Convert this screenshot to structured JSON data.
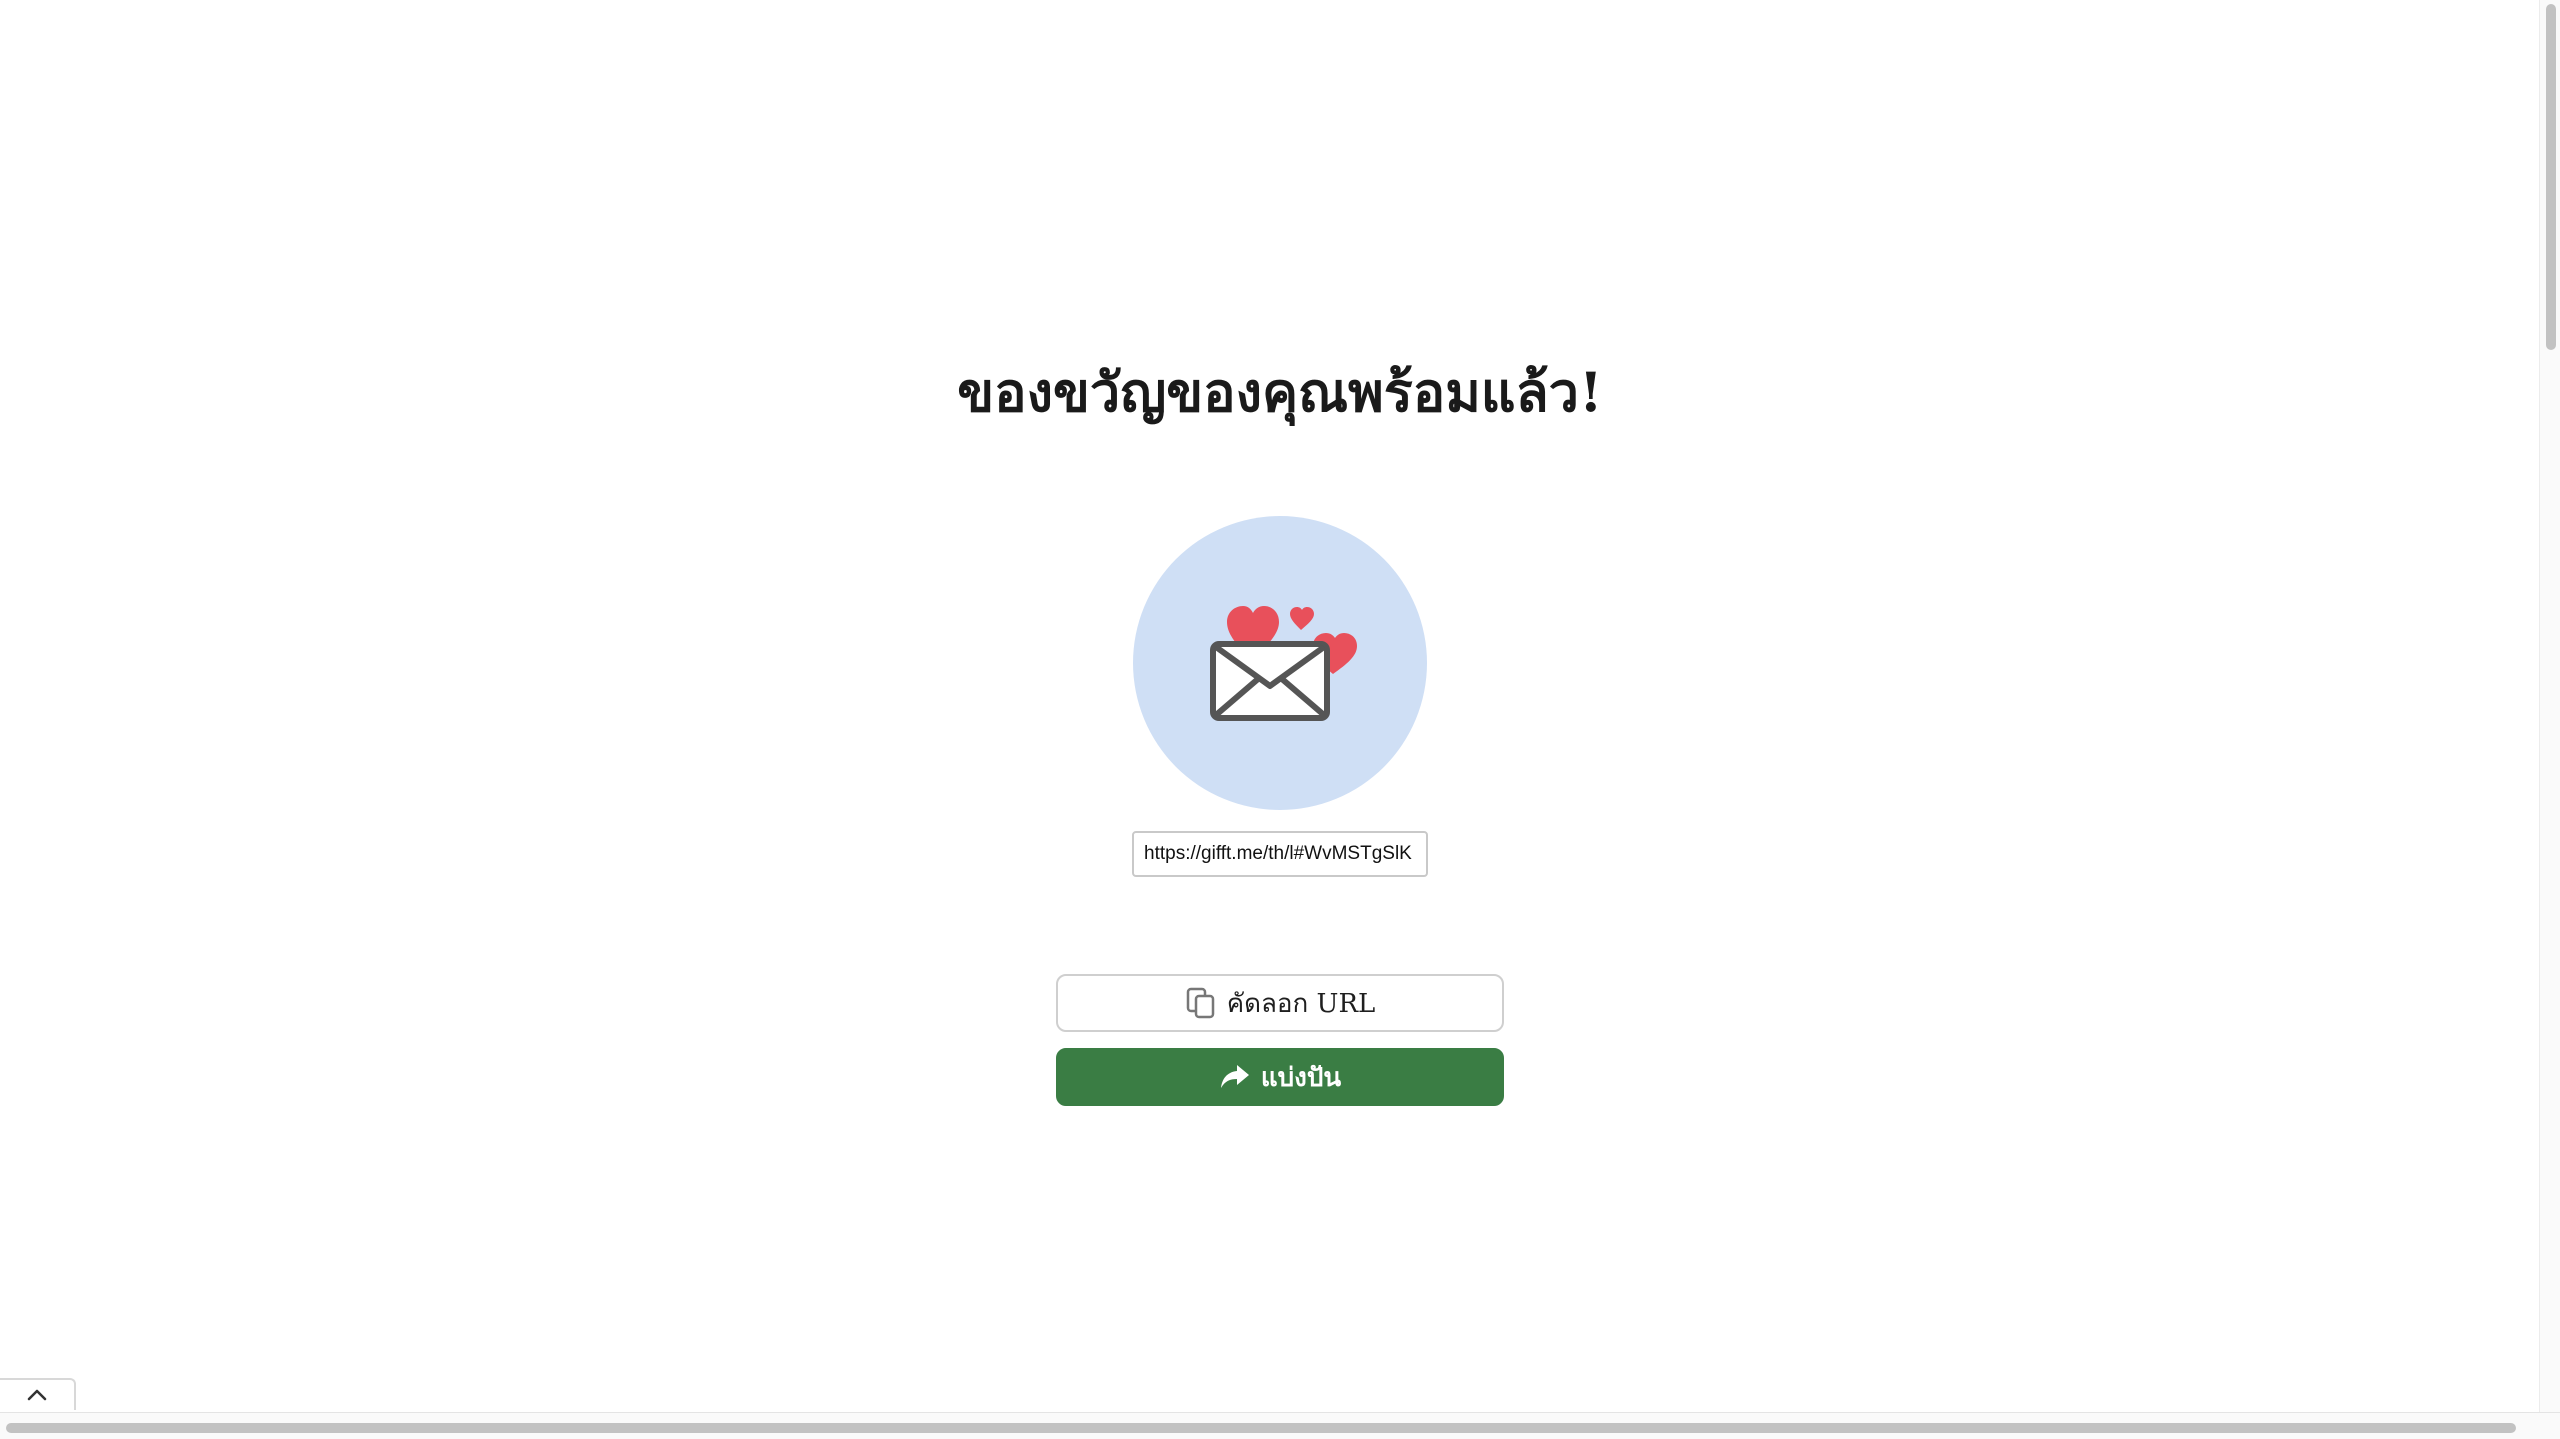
{
  "page": {
    "title": "ของขวัญของคุณพร้อมแล้ว!"
  },
  "illustration": {
    "icon": "envelope-with-hearts-icon",
    "background_color": "#cfdff5",
    "heart_color": "#e8505b",
    "envelope_stroke_color": "#555555"
  },
  "link": {
    "url_value": "https://gifft.me/th/l#WvMSTgSlK"
  },
  "actions": {
    "copy_label": "คัดลอก URL",
    "copy_icon": "copy-icon",
    "share_label": "แบ่งปัน",
    "share_icon": "share-arrow-icon",
    "share_color": "#3a7d44"
  },
  "controls": {
    "scroll_top_icon": "chevron-up-icon"
  }
}
